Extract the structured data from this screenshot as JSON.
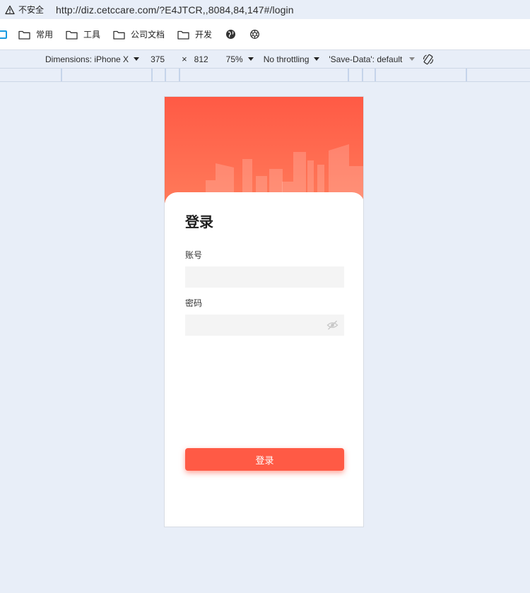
{
  "browser": {
    "security_label": "不安全",
    "url": "http://diz.cetccare.com/?E4JTCR,,8084,84,147#/login"
  },
  "bookmarks": [
    {
      "label": "常用",
      "icon": "folder-icon"
    },
    {
      "label": "工具",
      "icon": "folder-icon"
    },
    {
      "label": "公司文档",
      "icon": "folder-icon"
    },
    {
      "label": "开发",
      "icon": "folder-icon"
    }
  ],
  "devtools": {
    "dimensions_label": "Dimensions: iPhone X",
    "width": "375",
    "times": "×",
    "height": "812",
    "zoom": "75%",
    "throttling": "No throttling",
    "save_data": "'Save-Data': default"
  },
  "app": {
    "title": "登录",
    "account_label": "账号",
    "account_value": "",
    "password_label": "密码",
    "password_value": "",
    "login_button": "登录",
    "colors": {
      "accent": "#ff5a45",
      "hero_top": "#ff5a45",
      "hero_bottom": "#ff7a5a"
    }
  }
}
